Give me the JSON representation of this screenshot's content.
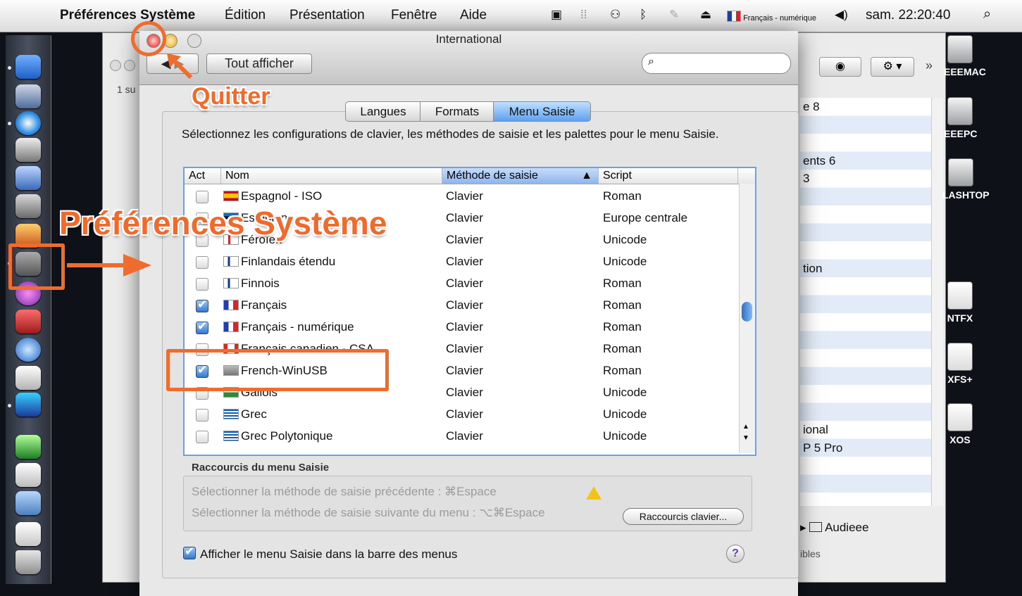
{
  "menubar": {
    "app_name": "Préférences Système",
    "menus": [
      "Édition",
      "Présentation",
      "Fenêtre",
      "Aide"
    ],
    "input_menu": "Français - numérique",
    "clock": "sam. 22:20:40"
  },
  "window": {
    "title": "International",
    "show_all": "Tout afficher",
    "search_placeholder": ""
  },
  "tabs": [
    {
      "label": "Langues",
      "selected": false
    },
    {
      "label": "Formats",
      "selected": false
    },
    {
      "label": "Menu Saisie",
      "selected": true
    }
  ],
  "description": "Sélectionnez les configurations de clavier, les méthodes de saisie et les palettes pour le menu Saisie.",
  "table": {
    "columns": [
      "Act",
      "Nom",
      "Méthode de saisie",
      "Script"
    ],
    "rows": [
      {
        "checked": false,
        "name": "Espagnol - ISO",
        "method": "Clavier",
        "script": "Roman"
      },
      {
        "checked": false,
        "name": "Estonien",
        "method": "Clavier",
        "script": "Europe centrale"
      },
      {
        "checked": false,
        "name": "Féroïen",
        "method": "Clavier",
        "script": "Unicode"
      },
      {
        "checked": false,
        "name": "Finlandais étendu",
        "method": "Clavier",
        "script": "Unicode"
      },
      {
        "checked": false,
        "name": "Finnois",
        "method": "Clavier",
        "script": "Roman"
      },
      {
        "checked": true,
        "name": "Français",
        "method": "Clavier",
        "script": "Roman"
      },
      {
        "checked": true,
        "name": "Français - numérique",
        "method": "Clavier",
        "script": "Roman"
      },
      {
        "checked": false,
        "name": "Français canadien - CSA",
        "method": "Clavier",
        "script": "Roman"
      },
      {
        "checked": true,
        "name": "French-WinUSB",
        "method": "Clavier",
        "script": "Roman"
      },
      {
        "checked": false,
        "name": "Gallois",
        "method": "Clavier",
        "script": "Unicode"
      },
      {
        "checked": false,
        "name": "Grec",
        "method": "Clavier",
        "script": "Unicode"
      },
      {
        "checked": false,
        "name": "Grec Polytonique",
        "method": "Clavier",
        "script": "Unicode"
      }
    ]
  },
  "shortcuts": {
    "title": "Raccourcis du menu Saisie",
    "previous": "Sélectionner la méthode de saisie précédente : ⌘Espace",
    "next": "Sélectionner la méthode de saisie suivante du menu : ⌥⌘Espace",
    "button": "Raccourcis clavier..."
  },
  "show_menu": {
    "checked": true,
    "label": "Afficher le menu Saisie dans la barre des menus"
  },
  "help": "?",
  "annotations": {
    "quit": "Quitter",
    "prefs": "Préférences Système"
  },
  "background_window": {
    "lines": [
      "e 8",
      "",
      "",
      "ents 6",
      "3",
      "",
      "",
      "",
      "",
      "tion",
      "",
      "",
      "",
      "",
      "",
      "",
      "",
      "",
      "ional",
      "P 5 Pro"
    ],
    "footer_item": "Audieee",
    "footer_status": "ibles"
  },
  "drives": [
    "EEEMAC",
    "EEEPC",
    "LASHTOP",
    "NTFX",
    "XFS+",
    "XOS"
  ],
  "colors": {
    "annotation": "#ef6b2e",
    "selection": "#5da0ee"
  }
}
